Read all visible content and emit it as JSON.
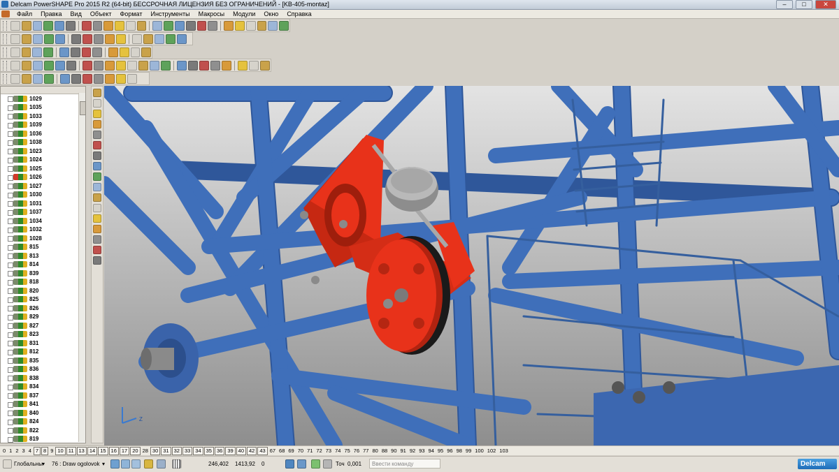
{
  "window": {
    "title": "Delcam PowerSHAPE Pro 2015 R2 (64-bit) БЕССРОЧНАЯ ЛИЦЕНЗИЯ БЕЗ ОГРАНИЧЕНИЙ - [KB-405-montaz]"
  },
  "menu": [
    "Файл",
    "Правка",
    "Вид",
    "Объект",
    "Формат",
    "Инструменты",
    "Макросы",
    "Модули",
    "Окно",
    "Справка"
  ],
  "tree": {
    "items": [
      "1029",
      "1035",
      "1033",
      "1039",
      "1036",
      "1038",
      "1023",
      "1024",
      "1025",
      "1026",
      "1027",
      "1030",
      "1031",
      "1037",
      "1034",
      "1032",
      "1028",
      "815",
      "813",
      "814",
      "839",
      "818",
      "820",
      "825",
      "826",
      "829",
      "827",
      "823",
      "831",
      "812",
      "835",
      "836",
      "838",
      "834",
      "837",
      "841",
      "840",
      "824",
      "822",
      "819"
    ],
    "highlighted_item": "1026"
  },
  "layers": [
    "0",
    "1",
    "2",
    "3",
    "4",
    "7",
    "8",
    "9",
    "10",
    "11",
    "13",
    "14",
    "15",
    "16",
    "17",
    "20",
    "28",
    "30",
    "31",
    "32",
    "33",
    "34",
    "35",
    "36",
    "39",
    "40",
    "42",
    "43",
    "67",
    "68",
    "69",
    "70",
    "71",
    "72",
    "73",
    "74",
    "75",
    "76",
    "77",
    "80",
    "88",
    "90",
    "91",
    "92",
    "93",
    "94",
    "95",
    "96",
    "98",
    "99",
    "100",
    "102",
    "103"
  ],
  "layers_boxed": [
    "7",
    "8",
    "10",
    "11",
    "13",
    "14",
    "15",
    "16",
    "17",
    "20",
    "30",
    "31",
    "32",
    "33",
    "34",
    "35",
    "36",
    "39",
    "40",
    "42",
    "43"
  ],
  "status": {
    "workplane": "Глобальны",
    "level": "76 : Draw ogolovok",
    "x": "246,402",
    "y": "1413,92",
    "z": "0",
    "tolerance_label": "Точ",
    "tolerance": "0,001",
    "command_placeholder": "Ввести команду",
    "brand": "Delcam"
  },
  "triad": {
    "label": "Z"
  },
  "colors": {
    "frame": "#3f6fba",
    "part": "#e8321a",
    "background": "#b8b8b8"
  }
}
